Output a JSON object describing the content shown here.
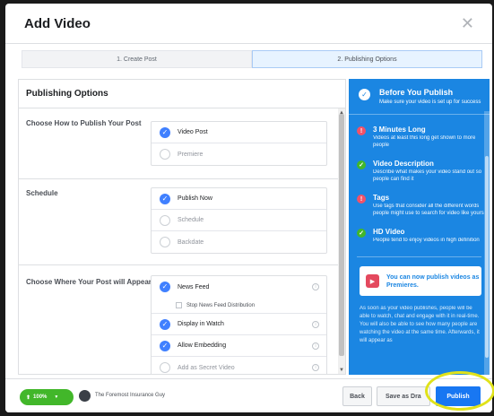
{
  "dialog": {
    "title": "Add Video",
    "close_icon": "close-icon"
  },
  "steps": [
    {
      "label": "1. Create Post",
      "active": false
    },
    {
      "label": "2. Publishing Options",
      "active": true
    }
  ],
  "left": {
    "heading": "Publishing Options",
    "publish_how": {
      "label": "Choose How to Publish Your Post",
      "options": [
        {
          "label": "Video Post",
          "selected": true
        },
        {
          "label": "Premiere",
          "selected": false
        }
      ]
    },
    "schedule": {
      "label": "Schedule",
      "options": [
        {
          "label": "Publish Now",
          "selected": true
        },
        {
          "label": "Schedule",
          "selected": false
        },
        {
          "label": "Backdate",
          "selected": false
        }
      ]
    },
    "where": {
      "label": "Choose Where Your Post will Appear",
      "options": [
        {
          "label": "News Feed",
          "selected": true
        },
        {
          "label": "Display in Watch",
          "selected": true
        },
        {
          "label": "Allow Embedding",
          "selected": true
        },
        {
          "label": "Add as Secret Video",
          "selected": false
        }
      ],
      "sub_checkbox": "Stop News Feed Distribution"
    }
  },
  "right": {
    "title": "Before You Publish",
    "subtitle": "Make sure your video is set up for success",
    "tips": [
      {
        "title": "3 Minutes Long",
        "desc": "Videos at least this long get shown to more people",
        "status": "warn"
      },
      {
        "title": "Video Description",
        "desc": "Describe what makes your video stand out so people can find it",
        "status": "ok"
      },
      {
        "title": "Tags",
        "desc": "Use tags that consider all the different words people might use to search for video like yours",
        "status": "warn"
      },
      {
        "title": "HD Video",
        "desc": "People tend to enjoy videos in high definition",
        "status": "ok"
      }
    ],
    "premiere_card": "You can now publish videos as Premieres.",
    "body": "As soon as your video publishes, people will be able to watch, chat and engage with it in real-time. You will also be able to see how many people are watching the video at the same time. Afterwards, it will appear as"
  },
  "footer": {
    "audience": "100%",
    "page_name": "The Foremost Insurance Guy",
    "back": "Back",
    "save_draft": "Save as Dra",
    "publish": "Publish"
  },
  "colors": {
    "accent": "#1877f2",
    "panel": "#1b86e2",
    "success": "#42b72a",
    "warn": "#f25268",
    "highlight": "#e0e21a"
  }
}
